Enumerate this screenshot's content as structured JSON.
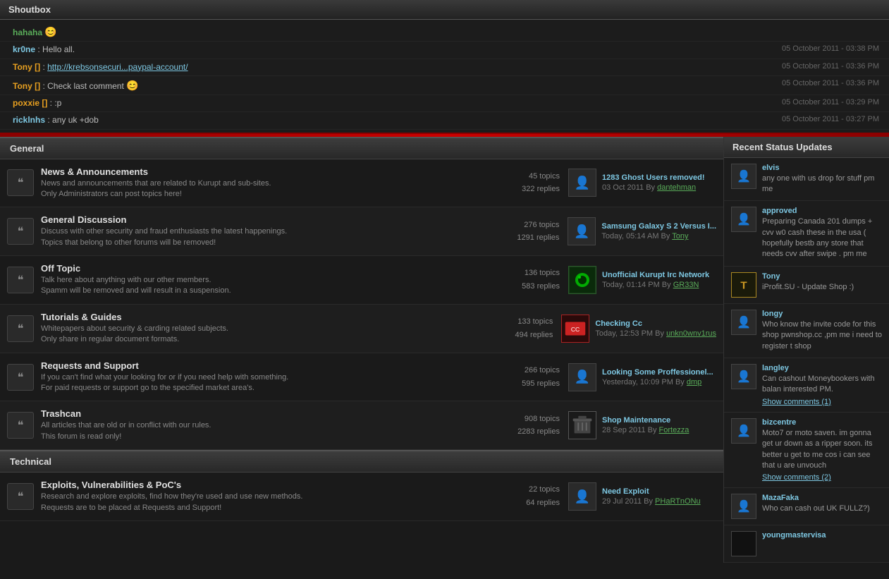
{
  "shoutbox": {
    "title": "Shoutbox",
    "messages": [
      {
        "user": "hahaha",
        "user_color": "green",
        "separator": ":",
        "msg": "😊",
        "time": ""
      },
      {
        "user": "kr0ne",
        "user_color": "default",
        "separator": ":",
        "msg": "Hello all.",
        "time": "05 October 2011 - 03:38 PM"
      },
      {
        "user": "Tony []",
        "user_color": "orange",
        "separator": ":",
        "msg": "http://krebsonsecuri...paypal-account/",
        "msg_link": true,
        "time": "05 October 2011 - 03:36 PM"
      },
      {
        "user": "Tony []",
        "user_color": "orange",
        "separator": ":",
        "msg": "Check last comment 😊",
        "time": "05 October 2011 - 03:36 PM"
      },
      {
        "user": "poxxie []",
        "user_color": "orange",
        "separator": ":",
        "msg": ":p",
        "time": "05 October 2011 - 03:29 PM"
      },
      {
        "user": "ricklnhs",
        "user_color": "default",
        "separator": ":",
        "msg": "any uk +dob",
        "time": "05 October 2011 - 03:27 PM"
      }
    ]
  },
  "sections": [
    {
      "name": "General",
      "forums": [
        {
          "title": "News & Announcements",
          "desc": "News and announcements that are related to Kurupt and sub-sites.",
          "desc2": "Only Administrators can post topics here!",
          "topics": "45 topics",
          "replies": "322 replies",
          "last_title": "1283 Ghost Users removed!",
          "last_date": "03 Oct 2011",
          "last_by": "By",
          "last_user": "dantehman"
        },
        {
          "title": "General Discussion",
          "desc": "Discuss with other security and fraud enthusiasts the latest happenings.",
          "desc2": "Topics that belong to other forums will be removed!",
          "topics": "276 topics",
          "replies": "1291 replies",
          "last_title": "Samsung Galaxy S 2 Versus I...",
          "last_date": "Today, 05:14 AM",
          "last_by": "By",
          "last_user": "Tony"
        },
        {
          "title": "Off Topic",
          "desc": "Talk here about anything with our other members.",
          "desc2": "Spamm will be removed and will result in a suspension.",
          "topics": "136 topics",
          "replies": "583 replies",
          "last_title": "Unofficial Kurupt Irc Network",
          "last_date": "Today, 01:14 PM",
          "last_by": "By",
          "last_user": "GR33N"
        },
        {
          "title": "Tutorials & Guides",
          "desc": "Whitepapers about security & carding related subjects.",
          "desc2": "Only share in regular document formats.",
          "topics": "133 topics",
          "replies": "494 replies",
          "last_title": "Checking Cc",
          "last_date": "Today, 12:53 PM",
          "last_by": "By",
          "last_user": "unkn0wnv1rus"
        },
        {
          "title": "Requests and Support",
          "desc": "If you can't find what your looking for or if you need help with something.",
          "desc2": "For paid requests or support go to the specified market area's.",
          "topics": "266 topics",
          "replies": "595 replies",
          "last_title": "Looking Some Proffessionel...",
          "last_date": "Yesterday, 10:09 PM",
          "last_by": "By",
          "last_user": "dmp"
        },
        {
          "title": "Trashcan",
          "desc": "All articles that are old or in conflict with our rules.",
          "desc2": "This forum is read only!",
          "topics": "908 topics",
          "replies": "2283 replies",
          "last_title": "Shop Maintenance",
          "last_date": "28 Sep 2011",
          "last_by": "By",
          "last_user": "Fortezza"
        }
      ]
    },
    {
      "name": "Technical",
      "forums": [
        {
          "title": "Exploits, Vulnerabilities & PoC's",
          "desc": "Research and explore exploits, find how they're used and use new methods.",
          "desc2": "Requests are to be placed at Requests and Support!",
          "topics": "22 topics",
          "replies": "64 replies",
          "last_title": "Need Exploit",
          "last_date": "29 Jul 2011",
          "last_by": "By",
          "last_user": "PHaRTnONu"
        }
      ]
    }
  ],
  "sidebar": {
    "title": "Recent Status Updates",
    "items": [
      {
        "user": "elvis",
        "text": "any one with us drop for stuff pm me",
        "show_comments": null
      },
      {
        "user": "approved",
        "text": "Preparing Canada 201 dumps + cvv w0 cash these in the usa ( hopefully bestb any store that needs cvv after swipe . pm me",
        "show_comments": null
      },
      {
        "user": "Tony",
        "text": "iProfit.SU - Update Shop :)",
        "show_comments": null
      },
      {
        "user": "longy",
        "text": "Who know the invite code for this shop pwnshop.cc ,pm me i need to register t shop",
        "show_comments": null
      },
      {
        "user": "langley",
        "text": "Can cashout Moneybookers with balan interested PM.",
        "show_comments": "Show comments (1)"
      },
      {
        "user": "bizcentre",
        "text": "Moto7 or moto saven. im gonna get ur down as a ripper soon. its better u get to me cos i can see that u are unvouch",
        "show_comments": "Show comments (2)"
      },
      {
        "user": "MazaFaka",
        "text": "Who can cash out UK FULLZ?)",
        "show_comments": null
      },
      {
        "user": "youngmastervisa",
        "text": "",
        "show_comments": null
      }
    ]
  }
}
